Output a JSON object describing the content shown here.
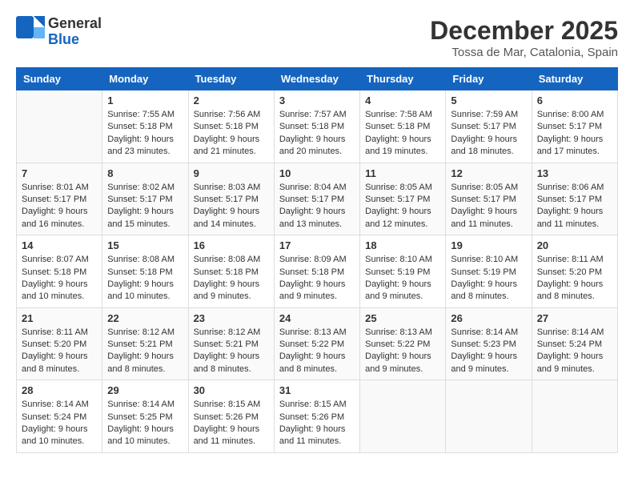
{
  "logo": {
    "general": "General",
    "blue": "Blue"
  },
  "title": "December 2025",
  "location": "Tossa de Mar, Catalonia, Spain",
  "days_header": [
    "Sunday",
    "Monday",
    "Tuesday",
    "Wednesday",
    "Thursday",
    "Friday",
    "Saturday"
  ],
  "weeks": [
    [
      {
        "day": "",
        "info": ""
      },
      {
        "day": "1",
        "info": "Sunrise: 7:55 AM\nSunset: 5:18 PM\nDaylight: 9 hours\nand 23 minutes."
      },
      {
        "day": "2",
        "info": "Sunrise: 7:56 AM\nSunset: 5:18 PM\nDaylight: 9 hours\nand 21 minutes."
      },
      {
        "day": "3",
        "info": "Sunrise: 7:57 AM\nSunset: 5:18 PM\nDaylight: 9 hours\nand 20 minutes."
      },
      {
        "day": "4",
        "info": "Sunrise: 7:58 AM\nSunset: 5:18 PM\nDaylight: 9 hours\nand 19 minutes."
      },
      {
        "day": "5",
        "info": "Sunrise: 7:59 AM\nSunset: 5:17 PM\nDaylight: 9 hours\nand 18 minutes."
      },
      {
        "day": "6",
        "info": "Sunrise: 8:00 AM\nSunset: 5:17 PM\nDaylight: 9 hours\nand 17 minutes."
      }
    ],
    [
      {
        "day": "7",
        "info": "Sunrise: 8:01 AM\nSunset: 5:17 PM\nDaylight: 9 hours\nand 16 minutes."
      },
      {
        "day": "8",
        "info": "Sunrise: 8:02 AM\nSunset: 5:17 PM\nDaylight: 9 hours\nand 15 minutes."
      },
      {
        "day": "9",
        "info": "Sunrise: 8:03 AM\nSunset: 5:17 PM\nDaylight: 9 hours\nand 14 minutes."
      },
      {
        "day": "10",
        "info": "Sunrise: 8:04 AM\nSunset: 5:17 PM\nDaylight: 9 hours\nand 13 minutes."
      },
      {
        "day": "11",
        "info": "Sunrise: 8:05 AM\nSunset: 5:17 PM\nDaylight: 9 hours\nand 12 minutes."
      },
      {
        "day": "12",
        "info": "Sunrise: 8:05 AM\nSunset: 5:17 PM\nDaylight: 9 hours\nand 11 minutes."
      },
      {
        "day": "13",
        "info": "Sunrise: 8:06 AM\nSunset: 5:17 PM\nDaylight: 9 hours\nand 11 minutes."
      }
    ],
    [
      {
        "day": "14",
        "info": "Sunrise: 8:07 AM\nSunset: 5:18 PM\nDaylight: 9 hours\nand 10 minutes."
      },
      {
        "day": "15",
        "info": "Sunrise: 8:08 AM\nSunset: 5:18 PM\nDaylight: 9 hours\nand 10 minutes."
      },
      {
        "day": "16",
        "info": "Sunrise: 8:08 AM\nSunset: 5:18 PM\nDaylight: 9 hours\nand 9 minutes."
      },
      {
        "day": "17",
        "info": "Sunrise: 8:09 AM\nSunset: 5:18 PM\nDaylight: 9 hours\nand 9 minutes."
      },
      {
        "day": "18",
        "info": "Sunrise: 8:10 AM\nSunset: 5:19 PM\nDaylight: 9 hours\nand 9 minutes."
      },
      {
        "day": "19",
        "info": "Sunrise: 8:10 AM\nSunset: 5:19 PM\nDaylight: 9 hours\nand 8 minutes."
      },
      {
        "day": "20",
        "info": "Sunrise: 8:11 AM\nSunset: 5:20 PM\nDaylight: 9 hours\nand 8 minutes."
      }
    ],
    [
      {
        "day": "21",
        "info": "Sunrise: 8:11 AM\nSunset: 5:20 PM\nDaylight: 9 hours\nand 8 minutes."
      },
      {
        "day": "22",
        "info": "Sunrise: 8:12 AM\nSunset: 5:21 PM\nDaylight: 9 hours\nand 8 minutes."
      },
      {
        "day": "23",
        "info": "Sunrise: 8:12 AM\nSunset: 5:21 PM\nDaylight: 9 hours\nand 8 minutes."
      },
      {
        "day": "24",
        "info": "Sunrise: 8:13 AM\nSunset: 5:22 PM\nDaylight: 9 hours\nand 8 minutes."
      },
      {
        "day": "25",
        "info": "Sunrise: 8:13 AM\nSunset: 5:22 PM\nDaylight: 9 hours\nand 9 minutes."
      },
      {
        "day": "26",
        "info": "Sunrise: 8:14 AM\nSunset: 5:23 PM\nDaylight: 9 hours\nand 9 minutes."
      },
      {
        "day": "27",
        "info": "Sunrise: 8:14 AM\nSunset: 5:24 PM\nDaylight: 9 hours\nand 9 minutes."
      }
    ],
    [
      {
        "day": "28",
        "info": "Sunrise: 8:14 AM\nSunset: 5:24 PM\nDaylight: 9 hours\nand 10 minutes."
      },
      {
        "day": "29",
        "info": "Sunrise: 8:14 AM\nSunset: 5:25 PM\nDaylight: 9 hours\nand 10 minutes."
      },
      {
        "day": "30",
        "info": "Sunrise: 8:15 AM\nSunset: 5:26 PM\nDaylight: 9 hours\nand 11 minutes."
      },
      {
        "day": "31",
        "info": "Sunrise: 8:15 AM\nSunset: 5:26 PM\nDaylight: 9 hours\nand 11 minutes."
      },
      {
        "day": "",
        "info": ""
      },
      {
        "day": "",
        "info": ""
      },
      {
        "day": "",
        "info": ""
      }
    ]
  ]
}
